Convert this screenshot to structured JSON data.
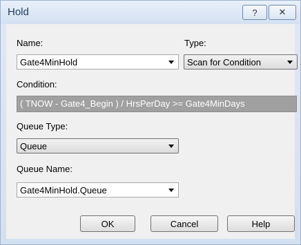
{
  "window": {
    "title": "Hold",
    "help_glyph": "?",
    "close_glyph": "✕"
  },
  "fields": {
    "name_label": "Name:",
    "name_value": "Gate4MinHold",
    "type_label": "Type:",
    "type_value": "Scan for Condition",
    "condition_label": "Condition:",
    "condition_value": "( TNOW - Gate4_Begin ) / HrsPerDay >= Gate4MinDays",
    "queue_type_label": "Queue Type:",
    "queue_type_value": "Queue",
    "queue_name_label": "Queue Name:",
    "queue_name_value": "Gate4MinHold.Queue"
  },
  "buttons": {
    "ok": "OK",
    "cancel": "Cancel",
    "help": "Help"
  }
}
